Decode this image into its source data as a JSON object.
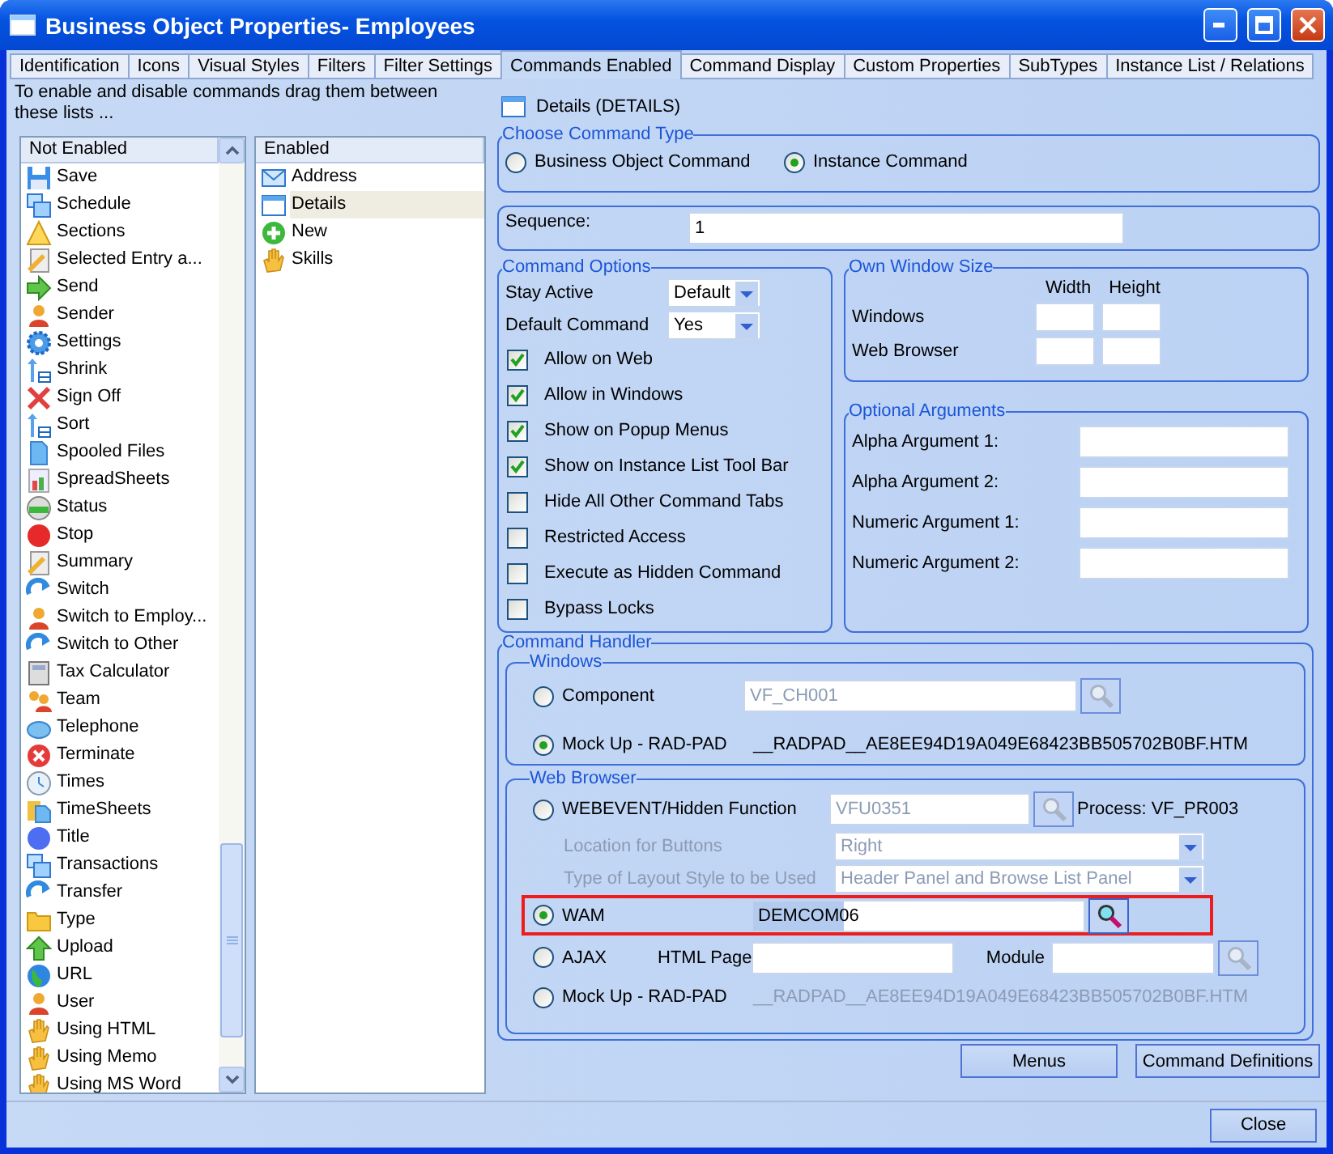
{
  "window": {
    "title": "Business Object Properties- Employees"
  },
  "tabs": [
    {
      "label": "Identification",
      "selected": false
    },
    {
      "label": "Icons",
      "selected": false
    },
    {
      "label": "Visual Styles",
      "selected": false
    },
    {
      "label": "Filters",
      "selected": false
    },
    {
      "label": "Filter Settings",
      "selected": false
    },
    {
      "label": "Commands Enabled",
      "selected": true
    },
    {
      "label": "Command Display",
      "selected": false
    },
    {
      "label": "Custom Properties",
      "selected": false
    },
    {
      "label": "SubTypes",
      "selected": false
    },
    {
      "label": "Instance List / Relations",
      "selected": false
    }
  ],
  "instructions": "To enable and disable commands drag them between these lists ...",
  "not_enabled": {
    "header": "Not Enabled",
    "items": [
      {
        "label": "Save"
      },
      {
        "label": "Schedule"
      },
      {
        "label": "Sections"
      },
      {
        "label": "Selected Entry a..."
      },
      {
        "label": "Send"
      },
      {
        "label": "Sender"
      },
      {
        "label": "Settings"
      },
      {
        "label": "Shrink"
      },
      {
        "label": "Sign Off"
      },
      {
        "label": "Sort"
      },
      {
        "label": "Spooled Files"
      },
      {
        "label": "SpreadSheets"
      },
      {
        "label": "Status"
      },
      {
        "label": "Stop"
      },
      {
        "label": "Summary"
      },
      {
        "label": "Switch"
      },
      {
        "label": "Switch to Employ..."
      },
      {
        "label": "Switch to Other"
      },
      {
        "label": "Tax Calculator"
      },
      {
        "label": "Team"
      },
      {
        "label": "Telephone"
      },
      {
        "label": "Terminate"
      },
      {
        "label": "Times"
      },
      {
        "label": "TimeSheets"
      },
      {
        "label": "Title"
      },
      {
        "label": "Transactions"
      },
      {
        "label": "Transfer"
      },
      {
        "label": "Type"
      },
      {
        "label": "Upload"
      },
      {
        "label": "URL"
      },
      {
        "label": "User"
      },
      {
        "label": "Using HTML"
      },
      {
        "label": "Using Memo"
      },
      {
        "label": "Using MS Word"
      }
    ]
  },
  "enabled": {
    "header": "Enabled",
    "items": [
      {
        "label": "Address",
        "selected": false
      },
      {
        "label": "Details",
        "selected": true
      },
      {
        "label": "New",
        "selected": false
      },
      {
        "label": "Skills",
        "selected": false
      }
    ]
  },
  "command": {
    "title": "Details (DETAILS)"
  },
  "command_type": {
    "legend": "Choose Command Type",
    "options": [
      {
        "label": "Business Object Command",
        "selected": false
      },
      {
        "label": "Instance Command",
        "selected": true
      }
    ]
  },
  "sequence": {
    "label": "Sequence:",
    "value": "1"
  },
  "command_options": {
    "legend": "Command Options",
    "dropdowns": [
      {
        "label": "Stay Active",
        "value": "Default"
      },
      {
        "label": "Default Command",
        "value": "Yes"
      }
    ],
    "checkboxes": [
      {
        "label": "Allow on Web",
        "checked": true
      },
      {
        "label": "Allow in Windows",
        "checked": true
      },
      {
        "label": "Show on Popup Menus",
        "checked": true
      },
      {
        "label": "Show on Instance List Tool Bar",
        "checked": true
      },
      {
        "label": "Hide All Other Command Tabs",
        "checked": false
      },
      {
        "label": "Restricted Access",
        "checked": false
      },
      {
        "label": "Execute as Hidden Command",
        "checked": false
      },
      {
        "label": "Bypass Locks",
        "checked": false
      }
    ]
  },
  "own_window_size": {
    "legend": "Own Window Size",
    "columns": [
      "Width",
      "Height"
    ],
    "rows": [
      "Windows",
      "Web Browser"
    ]
  },
  "optional_arguments": {
    "legend": "Optional Arguments",
    "fields": [
      "Alpha Argument 1:",
      "Alpha Argument 2:",
      "Numeric Argument 1:",
      "Numeric Argument 2:"
    ]
  },
  "command_handler": {
    "legend": "Command Handler",
    "windows": {
      "legend": "Windows",
      "component": {
        "label": "Component",
        "selected": false,
        "value": "VF_CH001"
      },
      "mockup": {
        "label": "Mock Up - RAD-PAD",
        "selected": true,
        "file": "__RADPAD__AE8EE94D19A049E68423BB505702B0BF.HTM"
      }
    },
    "web_browser": {
      "legend": "Web Browser",
      "webevent": {
        "label": "WEBEVENT/Hidden Function",
        "selected": false,
        "value": "VFU0351",
        "process": "Process: VF_PR003"
      },
      "location": {
        "label": "Location for Buttons",
        "value": "Right"
      },
      "layout": {
        "label": "Type of Layout Style to be Used",
        "value": "Header Panel and Browse List Panel"
      },
      "wam": {
        "label": "WAM",
        "selected": true,
        "value": "DEMCOM06",
        "highlighted": true
      },
      "ajax": {
        "label": "AJAX",
        "selected": false,
        "html_label": "HTML Page",
        "module_label": "Module"
      },
      "mockup": {
        "label": "Mock Up - RAD-PAD",
        "selected": false,
        "file": "__RADPAD__AE8EE94D19A049E68423BB505702B0BF.HTM"
      }
    }
  },
  "buttons": [
    "Menus",
    "Command Definitions"
  ],
  "close_button": "Close"
}
